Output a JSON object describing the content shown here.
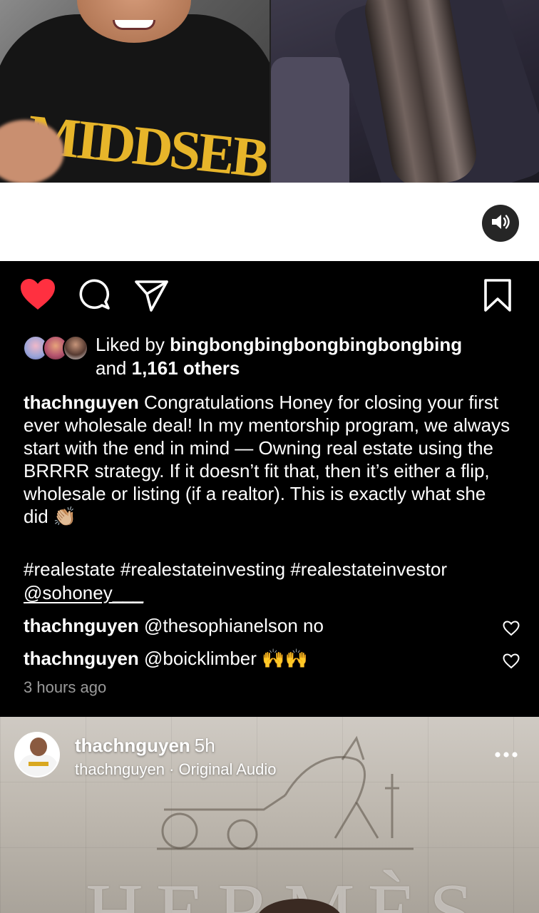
{
  "post": {
    "liked_by_prefix": "Liked by",
    "liked_by_user": "bingbongbingbongbingbongbing",
    "and_text": "and",
    "others_count": "1,161 others",
    "caption_user": "thachnguyen",
    "caption_text": "Congratulations Honey for closing your first ever wholesale deal! In my mentorship program, we always start with the end in mind — Owning real estate using the BRRRR strategy. If it doesn’t fit that, then it’s either a flip, wholesale or listing (if a realtor). This is exactly what she did 👏🏼",
    "hashtags": "#realestate #realestateinvesting #realestateinvestor",
    "mention": "@sohoney___",
    "comments": [
      {
        "user": "thachnguyen",
        "text": "@thesophianelson no"
      },
      {
        "user": "thachnguyen",
        "text": "@boicklimber 🙌🙌"
      }
    ],
    "timestamp": "3 hours ago",
    "liked": true
  },
  "video": {
    "hoodie_text": "MIDDSEB"
  },
  "next_reel": {
    "username": "thachnguyen",
    "age": "5h",
    "audio": "thachnguyen · Original Audio",
    "sign_text": "HERMÈS"
  },
  "icons": {
    "heart": "heart-filled-icon",
    "comment": "comment-icon",
    "share": "paper-plane-icon",
    "save": "bookmark-icon",
    "sound": "speaker-icon",
    "more": "more-dots-icon"
  },
  "colors": {
    "like_red": "#ff3040",
    "background": "#000000",
    "muted_text": "#9a9a9a"
  }
}
